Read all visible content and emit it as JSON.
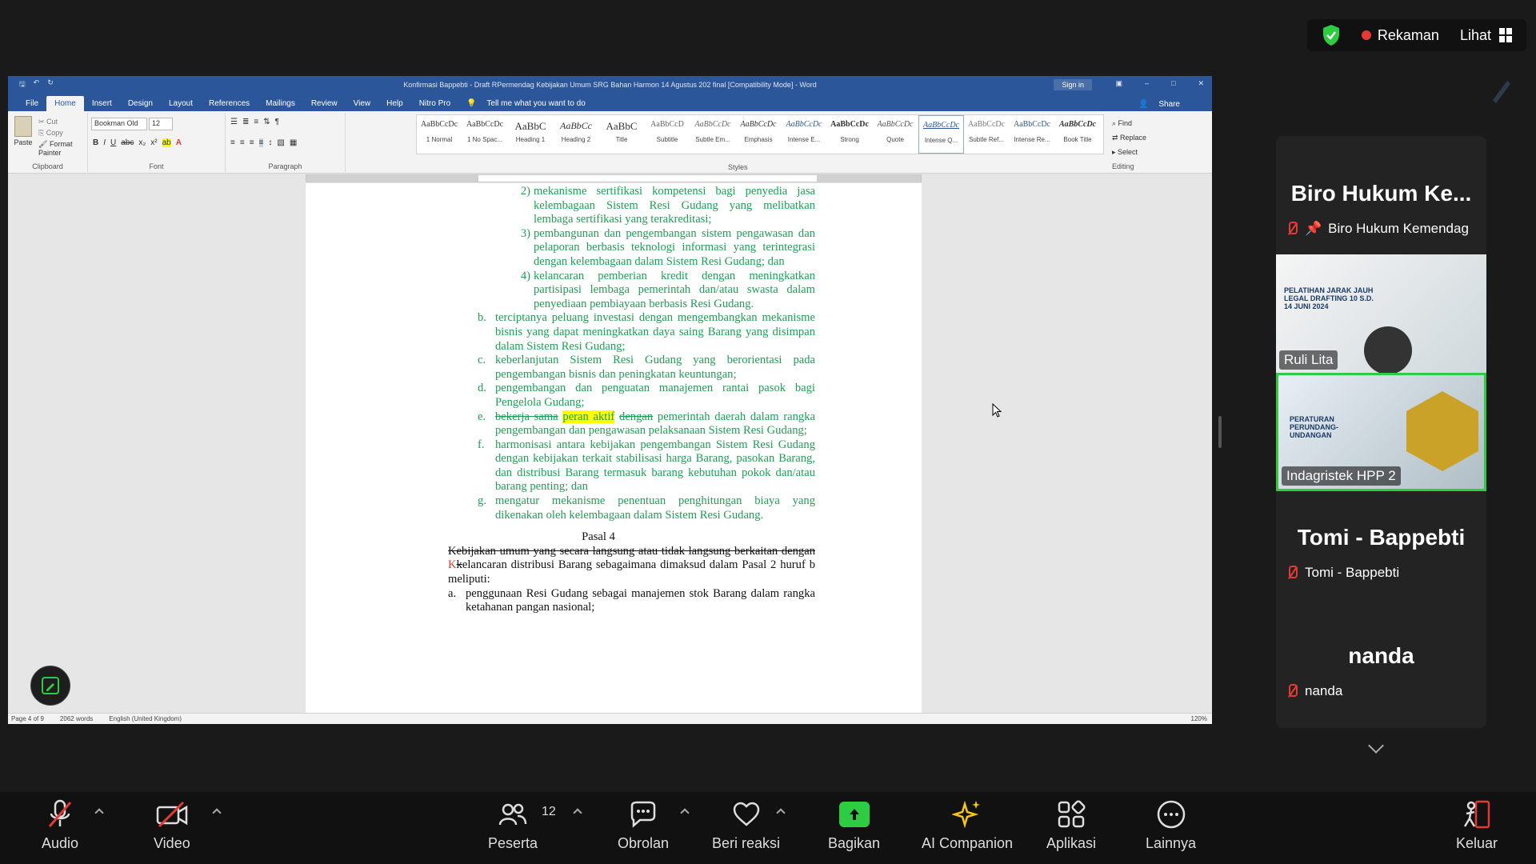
{
  "top": {
    "recording_label": "Rekaman",
    "view_label": "Lihat"
  },
  "word": {
    "title": "Konfirmasi Bappebti - Draft RPermendag Kebijakan Umum SRG Bahan Harmon 14 Agustus 202 final [Compatibility Mode] - Word",
    "sign_in": "Sign in",
    "tabs": [
      "File",
      "Home",
      "Insert",
      "Design",
      "Layout",
      "References",
      "Mailings",
      "Review",
      "View",
      "Help",
      "Nitro Pro"
    ],
    "tell_me": "Tell me what you want to do",
    "share": "Share",
    "clipboard": {
      "paste": "Paste",
      "cut": "Cut",
      "copy": "Copy",
      "format_painter": "Format Painter",
      "label": "Clipboard"
    },
    "font": {
      "name": "Bookman Old",
      "size": "12",
      "label": "Font"
    },
    "paragraph_label": "Paragraph",
    "styles_label": "Styles",
    "styles": [
      {
        "preview": "AaBbCcDc",
        "name": "1 Normal"
      },
      {
        "preview": "AaBbCcDc",
        "name": "1 No Spac..."
      },
      {
        "preview": "AaBbC",
        "name": "Heading 1"
      },
      {
        "preview": "AaBbCc",
        "name": "Heading 2"
      },
      {
        "preview": "AaBbC",
        "name": "Title"
      },
      {
        "preview": "AaBbCcD",
        "name": "Subtitle"
      },
      {
        "preview": "AaBbCcDc",
        "name": "Subtle Em..."
      },
      {
        "preview": "AaBbCcDc",
        "name": "Emphasis"
      },
      {
        "preview": "AaBbCcDc",
        "name": "Intense E..."
      },
      {
        "preview": "AaBbCcDc",
        "name": "Strong"
      },
      {
        "preview": "AaBbCcDc",
        "name": "Quote"
      },
      {
        "preview": "AaBbCcDc",
        "name": "Intense Q..."
      },
      {
        "preview": "AaBbCcDc",
        "name": "Subtle Ref..."
      },
      {
        "preview": "AaBbCcDc",
        "name": "Intense Re..."
      },
      {
        "preview": "AaBbCcDc",
        "name": "Book Title"
      }
    ],
    "editing": {
      "find": "Find",
      "replace": "Replace",
      "select": "Select",
      "label": "Editing"
    },
    "status": {
      "page": "Page 4 of 9",
      "words": "2062 words",
      "lang": "English (United Kingdom)",
      "zoom": "120%"
    }
  },
  "doc": {
    "i2": "mekanisme sertifikasi kompetensi bagi penyedia jasa kelembagaan Sistem Resi Gudang yang melibatkan lembaga sertifikasi yang terakreditasi;",
    "i3": "pembangunan dan pengembangan sistem pengawasan dan pelaporan berbasis teknologi informasi yang terintegrasi dengan kelembagaan dalam Sistem Resi Gudang; dan",
    "i4": "kelancaran pemberian kredit dengan meningkatkan partisipasi lembaga pemerintah dan/atau swasta dalam penyediaan pembiayaan berbasis Resi Gudang.",
    "b": "terciptanya peluang investasi dengan mengembangkan mekanisme bisnis yang dapat meningkatkan daya saing Barang yang disimpan dalam Sistem Resi Gudang;",
    "c": "keberlanjutan Sistem Resi Gudang yang berorientasi pada pengembangan bisnis dan peningkatan keuntungan;",
    "d": "pengembangan dan penguatan manajemen rantai pasok bagi Pengelola Gudang;",
    "e_strike1": "bekerja sama",
    "e_hl": "peran aktif",
    "e_strike2": "dengan",
    "e_rest": " pemerintah daerah dalam rangka pengembangan dan pengawasan pelaksanaan Sistem Resi Gudang;",
    "f": "harmonisasi antara kebijakan pengembangan Sistem Resi Gudang dengan kebijakan terkait stabilisasi harga Barang, pasokan Barang, dan distribusi Barang termasuk barang kebutuhan pokok dan/atau barang penting; dan",
    "g": "mengatur mekanisme penentuan penghitungan biaya yang dikenakan oleh kelembagaan dalam Sistem Resi Gudang.",
    "pasal": "Pasal 4",
    "p4_strike": "Kebijakan umum yang secara langsung atau tidak langsung berkaitan dengan",
    "p4_red": "K",
    "p4_strike_k": "k",
    "p4_rest": "elancaran distribusi Barang sebagaimana dimaksud dalam Pasal 2 huruf b meliputi:",
    "p4_a": "penggunaan Resi Gudang sebagai manajemen stok Barang dalam rangka ketahanan pangan nasional;"
  },
  "participants": [
    {
      "big_name": "Biro Hukum Ke...",
      "label": "Biro Hukum Kemendag"
    },
    {
      "label": "Ruli Lita",
      "banner": "PELATIHAN JARAK JAUH LEGAL DRAFTING 10 S.D. 14 JUNI 2024"
    },
    {
      "label": "Indagristek HPP 2",
      "banner": "PERATURAN PERUNDANG-UNDANGAN"
    },
    {
      "big_name": "Tomi - Bappebti",
      "label": "Tomi - Bappebti"
    },
    {
      "big_name": "nanda",
      "label": "nanda"
    }
  ],
  "toolbar": {
    "audio": "Audio",
    "video": "Video",
    "participants": "Peserta",
    "participant_count": "12",
    "chat": "Obrolan",
    "react": "Beri reaksi",
    "share": "Bagikan",
    "ai": "AI Companion",
    "apps": "Aplikasi",
    "more": "Lainnya",
    "leave": "Keluar"
  },
  "colors": {
    "word_blue": "#2b579a",
    "doc_green": "#1f9e55",
    "active_speaker": "#2ecc40",
    "share_green": "#2ecc40"
  }
}
